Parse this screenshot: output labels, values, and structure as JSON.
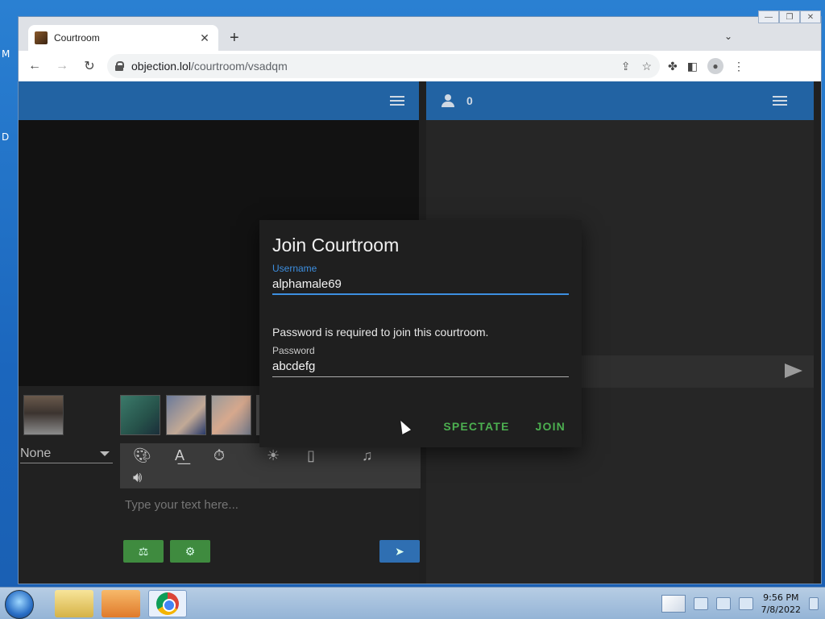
{
  "desktop": {
    "left_letters": [
      "M",
      "D"
    ]
  },
  "browser": {
    "tab_title": "Courtroom",
    "new_tab_symbol": "+",
    "tab_close_symbol": "✕",
    "url_host": "objection.lol",
    "url_path": "/courtroom/vsadqm",
    "window_controls": [
      "—",
      "❐",
      "✕"
    ]
  },
  "courtroom": {
    "user_count": "0",
    "character_select": "None",
    "text_placeholder": "Type your text here...",
    "dialog": {
      "title": "Join Courtroom",
      "username_label": "Username",
      "username_value": "alphamale69",
      "password_note": "Password is required to join this courtroom.",
      "password_label": "Password",
      "password_value": "abcdefg",
      "spectate_label": "SPECTATE",
      "join_label": "JOIN"
    },
    "tools": [
      "palette-icon",
      "text-format-icon",
      "timer-icon",
      "brightness-icon",
      "vibrate-icon",
      "music-icon",
      "volume-icon"
    ],
    "accent_colors": {
      "header": "#2263a3",
      "action_green": "#4caf50",
      "focus_blue": "#3d8fe0"
    }
  },
  "taskbar": {
    "time": "9:56 PM",
    "date": "7/8/2022"
  }
}
